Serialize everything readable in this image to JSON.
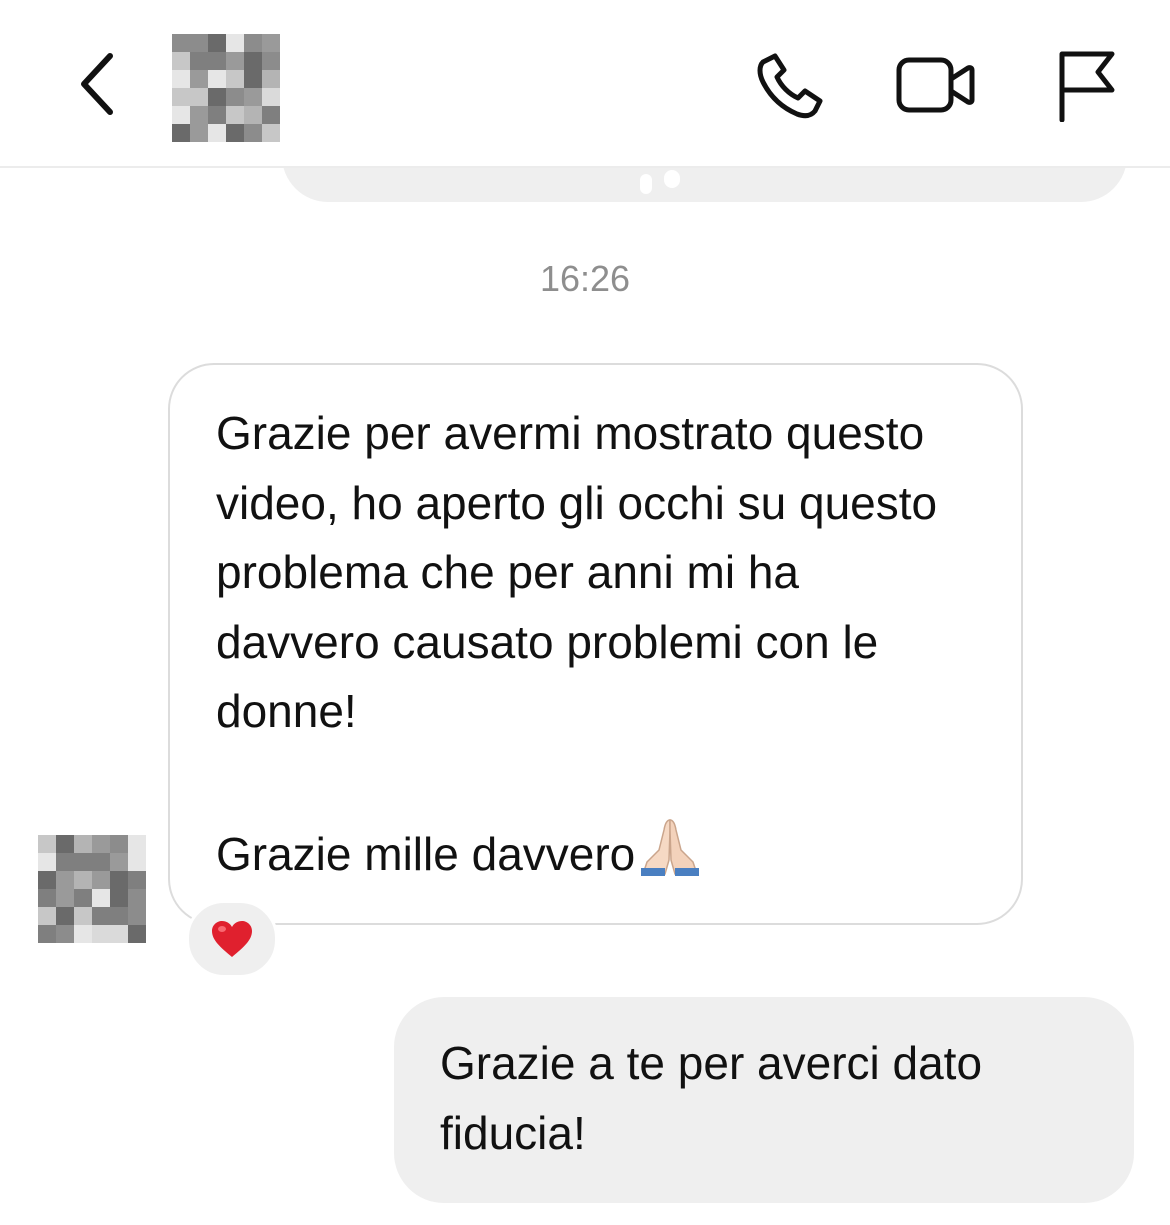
{
  "header": {
    "back_icon": "chevron-left-icon",
    "call_icon": "phone-icon",
    "video_icon": "video-camera-icon",
    "report_icon": "flag-icon"
  },
  "thread": {
    "timestamp": "16:26",
    "incoming": {
      "lines_p1": "Grazie per avermi mostrato questo video, ho aperto gli occhi su questo problema che per anni mi ha davvero causato problemi con le donne!",
      "lines_p2": "Grazie mille davvero",
      "emoji": "folded-hands-emoji",
      "reaction": "heart-emoji"
    },
    "outgoing": {
      "text": "Grazie a te per averci dato fiducia!"
    }
  },
  "colors": {
    "bubble_gray": "#efefef",
    "bubble_border": "#dcdcdc",
    "timestamp": "#8e8e8e",
    "heart": "#e0202e"
  }
}
